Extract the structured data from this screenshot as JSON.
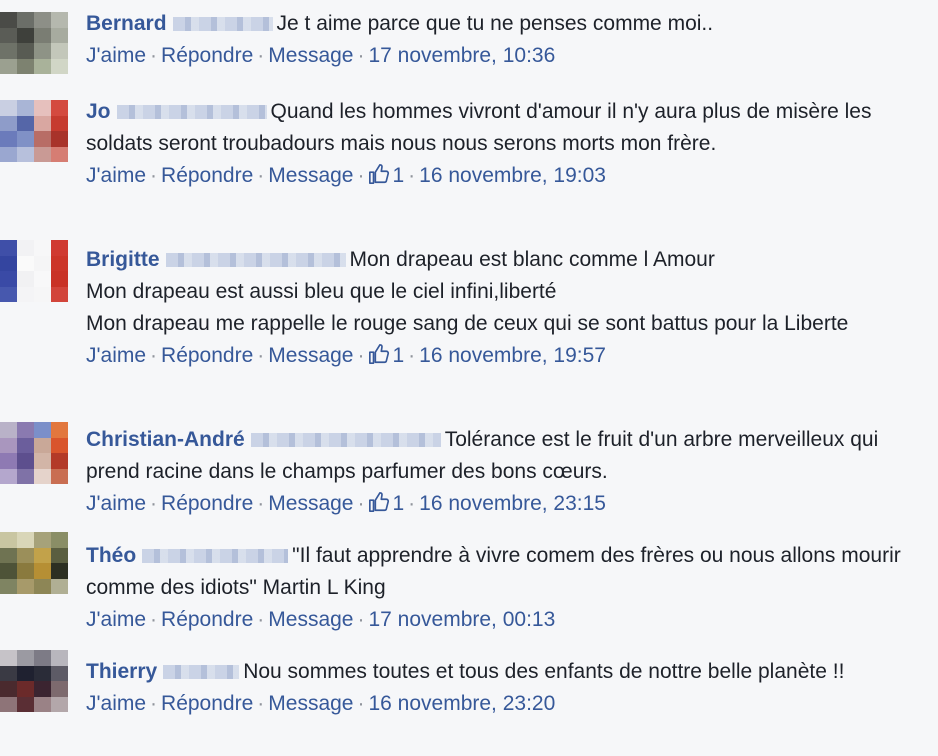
{
  "comments": [
    {
      "author": "Bernard",
      "text": "Je t aime parce que tu ne penses comme moi..",
      "actions": {
        "like": "J'aime",
        "reply": "Répondre",
        "message": "Message"
      },
      "likes": null,
      "time": "17 novembre, 10:36"
    },
    {
      "author": "Jo",
      "text": "Quand les hommes vivront d'amour il n'y aura plus de misère les soldats seront troubadours mais nous nous serons morts mon frère.",
      "actions": {
        "like": "J'aime",
        "reply": "Répondre",
        "message": "Message"
      },
      "likes": "1",
      "time": "16 novembre, 19:03"
    },
    {
      "author": "Brigitte",
      "text_lines": [
        "Mon drapeau est blanc comme l Amour",
        "Mon drapeau est aussi bleu que le ciel infini,liberté",
        "Mon drapeau me rappelle le rouge sang de ceux qui se sont battus pour la Liberte"
      ],
      "actions": {
        "like": "J'aime",
        "reply": "Répondre",
        "message": "Message"
      },
      "likes": "1",
      "time": "16 novembre, 19:57"
    },
    {
      "author": "Christian-André",
      "text": "Tolérance est le fruit d'un arbre merveilleux qui prend racine dans le champs parfumer des bons cœurs.",
      "actions": {
        "like": "J'aime",
        "reply": "Répondre",
        "message": "Message"
      },
      "likes": "1",
      "time": "16 novembre, 23:15"
    },
    {
      "author": "Théo",
      "text": "\"Il faut apprendre à vivre comem des frères ou nous allons mourir comme des idiots\" Martin L King",
      "actions": {
        "like": "J'aime",
        "reply": "Répondre",
        "message": "Message"
      },
      "likes": null,
      "time": "17 novembre, 00:13"
    },
    {
      "author": "Thierry",
      "text": "Nou sommes toutes et tous des enfants de nottre belle planète !!",
      "actions": {
        "like": "J'aime",
        "reply": "Répondre",
        "message": "Message"
      },
      "likes": null,
      "time": "16 novembre, 23:20"
    }
  ],
  "colors": {
    "author": "#365899",
    "link": "#365899",
    "meta": "#90949c",
    "background": "#f6f7f9"
  },
  "icons": {
    "like_count": "thumbs-up-icon"
  }
}
